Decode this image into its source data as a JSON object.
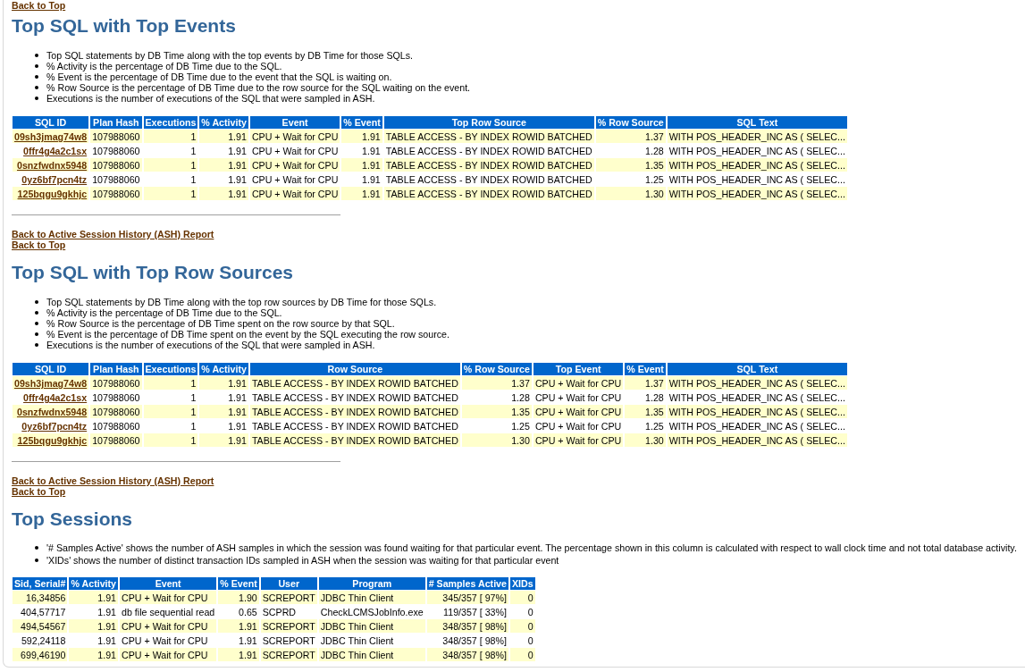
{
  "top_links": [
    "Back to Top"
  ],
  "sections": [
    {
      "title": "Top SQL with Top Events",
      "notes": [
        "Top SQL statements by DB Time along with the top events by DB Time for those SQLs.",
        "% Activity is the percentage of DB Time due to the SQL.",
        "% Event is the percentage of DB Time due to the event that the SQL is waiting on.",
        "% Row Source is the percentage of DB Time due to the row source for the SQL waiting on the event.",
        "Executions is the number of executions of the SQL that were sampled in ASH."
      ],
      "table": {
        "columns": [
          {
            "label": "SQL ID",
            "kind": "link"
          },
          {
            "label": "Plan Hash",
            "kind": "text"
          },
          {
            "label": "Executions",
            "kind": "number"
          },
          {
            "label": "% Activity",
            "kind": "number"
          },
          {
            "label": "Event",
            "kind": "text"
          },
          {
            "label": "% Event",
            "kind": "number"
          },
          {
            "label": "Top Row Source",
            "kind": "text"
          },
          {
            "label": "% Row Source",
            "kind": "number"
          },
          {
            "label": "SQL Text",
            "kind": "text"
          }
        ],
        "rows": [
          [
            "09sh3jmag74w8",
            "107988060",
            "1",
            "1.91",
            "CPU + Wait for CPU",
            "1.91",
            "TABLE ACCESS - BY INDEX ROWID BATCHED",
            "1.37",
            "WITH POS_HEADER_INC AS ( SELEC..."
          ],
          [
            "0ffr4g4a2c1sx",
            "107988060",
            "1",
            "1.91",
            "CPU + Wait for CPU",
            "1.91",
            "TABLE ACCESS - BY INDEX ROWID BATCHED",
            "1.28",
            "WITH POS_HEADER_INC AS ( SELEC..."
          ],
          [
            "0snzfwdnx5948",
            "107988060",
            "1",
            "1.91",
            "CPU + Wait for CPU",
            "1.91",
            "TABLE ACCESS - BY INDEX ROWID BATCHED",
            "1.35",
            "WITH POS_HEADER_INC AS ( SELEC..."
          ],
          [
            "0yz6bf7pcn4tz",
            "107988060",
            "1",
            "1.91",
            "CPU + Wait for CPU",
            "1.91",
            "TABLE ACCESS - BY INDEX ROWID BATCHED",
            "1.25",
            "WITH POS_HEADER_INC AS ( SELEC..."
          ],
          [
            "125bqgu9gkhjc",
            "107988060",
            "1",
            "1.91",
            "CPU + Wait for CPU",
            "1.91",
            "TABLE ACCESS - BY INDEX ROWID BATCHED",
            "1.30",
            "WITH POS_HEADER_INC AS ( SELEC..."
          ]
        ]
      },
      "footer_links": [
        "Back to Active Session History (ASH) Report",
        "Back to Top"
      ]
    },
    {
      "title": "Top SQL with Top Row Sources",
      "notes": [
        "Top SQL statements by DB Time along with the top row sources by DB Time for those SQLs.",
        "% Activity is the percentage of DB Time due to the SQL.",
        "% Row Source is the percentage of DB Time spent on the row source by that SQL.",
        "% Event is the percentage of DB Time spent on the event by the SQL executing the row source.",
        "Executions is the number of executions of the SQL that were sampled in ASH."
      ],
      "table": {
        "columns": [
          {
            "label": "SQL ID",
            "kind": "link"
          },
          {
            "label": "Plan Hash",
            "kind": "text"
          },
          {
            "label": "Executions",
            "kind": "number"
          },
          {
            "label": "% Activity",
            "kind": "number"
          },
          {
            "label": "Row Source",
            "kind": "text"
          },
          {
            "label": "% Row Source",
            "kind": "number"
          },
          {
            "label": "Top Event",
            "kind": "text"
          },
          {
            "label": "% Event",
            "kind": "number"
          },
          {
            "label": "SQL Text",
            "kind": "text"
          }
        ],
        "rows": [
          [
            "09sh3jmag74w8",
            "107988060",
            "1",
            "1.91",
            "TABLE ACCESS - BY INDEX ROWID BATCHED",
            "1.37",
            "CPU + Wait for CPU",
            "1.37",
            "WITH POS_HEADER_INC AS ( SELEC..."
          ],
          [
            "0ffr4g4a2c1sx",
            "107988060",
            "1",
            "1.91",
            "TABLE ACCESS - BY INDEX ROWID BATCHED",
            "1.28",
            "CPU + Wait for CPU",
            "1.28",
            "WITH POS_HEADER_INC AS ( SELEC..."
          ],
          [
            "0snzfwdnx5948",
            "107988060",
            "1",
            "1.91",
            "TABLE ACCESS - BY INDEX ROWID BATCHED",
            "1.35",
            "CPU + Wait for CPU",
            "1.35",
            "WITH POS_HEADER_INC AS ( SELEC..."
          ],
          [
            "0yz6bf7pcn4tz",
            "107988060",
            "1",
            "1.91",
            "TABLE ACCESS - BY INDEX ROWID BATCHED",
            "1.25",
            "CPU + Wait for CPU",
            "1.25",
            "WITH POS_HEADER_INC AS ( SELEC..."
          ],
          [
            "125bqgu9gkhjc",
            "107988060",
            "1",
            "1.91",
            "TABLE ACCESS - BY INDEX ROWID BATCHED",
            "1.30",
            "CPU + Wait for CPU",
            "1.30",
            "WITH POS_HEADER_INC AS ( SELEC..."
          ]
        ]
      },
      "footer_links": [
        "Back to Active Session History (ASH) Report",
        "Back to Top"
      ]
    },
    {
      "title": "Top Sessions",
      "notes": [
        "'# Samples Active' shows the number of ASH samples in which the session was found waiting for that particular event. The percentage shown in this column is calculated with respect to wall clock time and not total database activity.",
        "'XIDs' shows the number of distinct transaction IDs sampled in ASH when the session was waiting for that particular event"
      ],
      "table": {
        "columns": [
          {
            "label": "Sid, Serial#",
            "kind": "number"
          },
          {
            "label": "% Activity",
            "kind": "number"
          },
          {
            "label": "Event",
            "kind": "text"
          },
          {
            "label": "% Event",
            "kind": "number"
          },
          {
            "label": "User",
            "kind": "text"
          },
          {
            "label": "Program",
            "kind": "text"
          },
          {
            "label": "# Samples Active",
            "kind": "number"
          },
          {
            "label": "XIDs",
            "kind": "number"
          }
        ],
        "rows": [
          [
            "16,34856",
            "1.91",
            "CPU + Wait for CPU",
            "1.90",
            "SCREPORT",
            "JDBC Thin Client",
            "345/357 [ 97%]",
            "0"
          ],
          [
            "404,57717",
            "1.91",
            "db file sequential read",
            "0.65",
            "SCPRD",
            "CheckLCMSJobInfo.exe",
            "119/357 [ 33%]",
            "0"
          ],
          [
            "494,54567",
            "1.91",
            "CPU + Wait for CPU",
            "1.91",
            "SCREPORT",
            "JDBC Thin Client",
            "348/357 [ 98%]",
            "0"
          ],
          [
            "592,24118",
            "1.91",
            "CPU + Wait for CPU",
            "1.91",
            "SCREPORT",
            "JDBC Thin Client",
            "348/357 [ 98%]",
            "0"
          ],
          [
            "699,46190",
            "1.91",
            "CPU + Wait for CPU",
            "1.91",
            "SCREPORT",
            "JDBC Thin Client",
            "348/357 [ 98%]",
            "0"
          ]
        ]
      }
    }
  ]
}
